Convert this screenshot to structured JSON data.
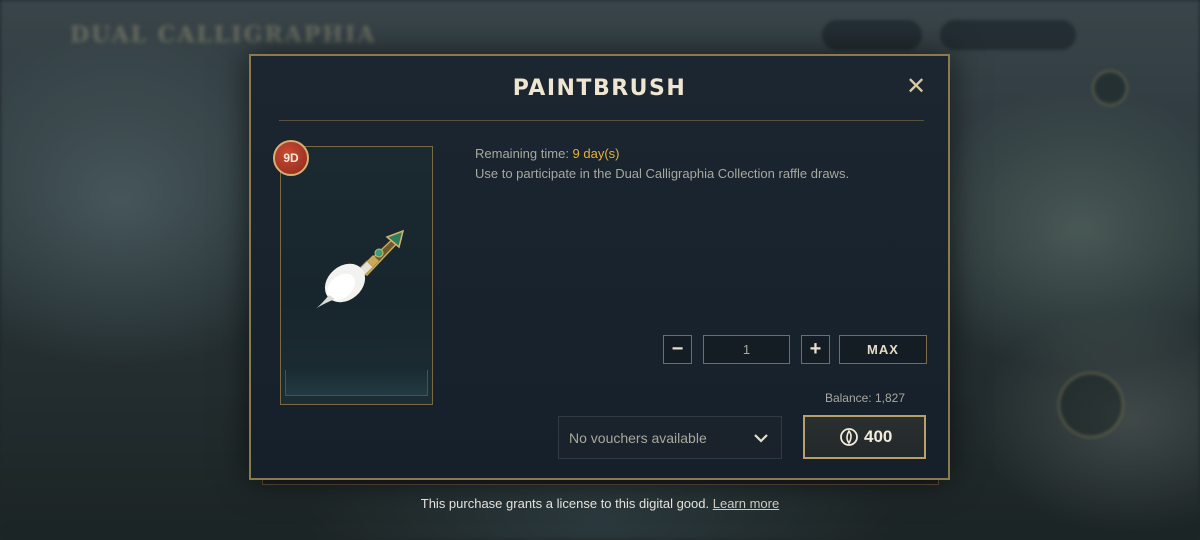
{
  "background": {
    "title": "DUAL CALLIGRAPHIA"
  },
  "modal": {
    "title": "PAINTBRUSH",
    "close_icon": "close-icon",
    "item": {
      "badge": "9D",
      "icon": "paintbrush-icon"
    },
    "info": {
      "remaining_label": "Remaining time: ",
      "remaining_value": "9 day(s)",
      "description": "Use to participate in the Dual Calligraphia Collection raffle draws."
    },
    "quantity": {
      "decrement_label": "−",
      "value": "1",
      "increment_label": "+",
      "max_label": "MAX"
    },
    "balance": "Balance: 1,827",
    "voucher": {
      "label": "No vouchers available",
      "icon": "chevron-down-icon"
    },
    "purchase": {
      "price": "400",
      "currency_icon": "currency-icon"
    }
  },
  "footer": {
    "legal_text": "This purchase grants a license to this digital good.",
    "learn_more": "Learn more"
  },
  "colors": {
    "accent_gold": "#8c7a4f",
    "remaining_highlight": "#e3b23c",
    "badge_red": "#b33a28",
    "modal_bg": "#1c2630"
  }
}
